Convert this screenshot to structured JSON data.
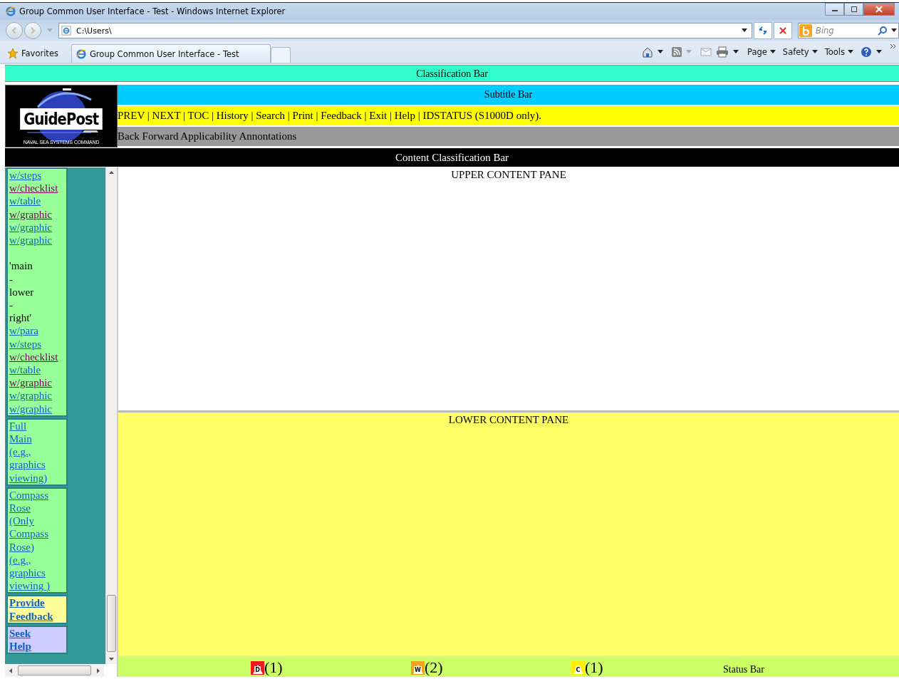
{
  "browser": {
    "title": "Group Common User Interface - Test - Windows Internet Explorer",
    "address": "C:\\Users\\",
    "search_placeholder": "Bing",
    "favorites": "Favorites",
    "tab_title": "Group Common User Interface - Test",
    "menus": [
      "Page",
      "Safety",
      "Tools"
    ]
  },
  "classification_bar": "Classification Bar",
  "logo": {
    "title": "GuidePost",
    "subtitle": "NAVAL SEA SYSTEMS COMMAND"
  },
  "subtitle_bar": "Subtitle Bar",
  "nav_bar": "PREV | NEXT | TOC | History | Search | Print | Feedback | Exit | Help | IDSTATUS (S1000D only).",
  "applicability_bar": "Back Forward Applicability Annontations",
  "content_classification_bar": "Content Classification Bar",
  "sidebar": {
    "boxes": [
      {
        "kind": "list",
        "items": [
          {
            "kind": "link",
            "text": "w/steps",
            "visited": false
          },
          {
            "kind": "link",
            "text": "w/checklist",
            "visited": true
          },
          {
            "kind": "link",
            "text": "w/table",
            "visited": false
          },
          {
            "kind": "link",
            "text": "w/graphic",
            "visited": true
          },
          {
            "kind": "link",
            "text": "w/graphic",
            "visited": false
          },
          {
            "kind": "link",
            "text": "w/graphic",
            "visited": false
          },
          {
            "kind": "note",
            "text": "'main\n-\nlower\n-\nright'"
          },
          {
            "kind": "link",
            "text": "w/para",
            "visited": false
          },
          {
            "kind": "link",
            "text": "w/steps",
            "visited": false
          },
          {
            "kind": "link",
            "text": "w/checklist",
            "visited": true
          },
          {
            "kind": "link",
            "text": "w/table",
            "visited": false
          },
          {
            "kind": "link",
            "text": "w/graphic",
            "visited": true
          },
          {
            "kind": "link",
            "text": "w/graphic",
            "visited": false
          },
          {
            "kind": "link",
            "text": "w/graphic",
            "visited": false
          }
        ]
      },
      {
        "kind": "list",
        "items": [
          {
            "kind": "link",
            "text": "Full\nMain\n(e.g.,\ngraphics\nviewing)",
            "visited": false
          }
        ]
      },
      {
        "kind": "list",
        "items": [
          {
            "kind": "link",
            "text": "Compass\nRose\n(Only\nCompass\nRose)\n(e.g.,\ngraphics\nviewing )",
            "visited": false
          }
        ]
      },
      {
        "kind": "feedback",
        "items": [
          {
            "kind": "link",
            "text": "Provide\nFeedback",
            "visited": false
          }
        ]
      },
      {
        "kind": "help",
        "items": [
          {
            "kind": "link",
            "text": "Seek\nHelp",
            "visited": false
          }
        ]
      }
    ]
  },
  "upper_pane": "UPPER CONTENT PANE",
  "lower_pane": "LOWER CONTENT PANE",
  "status_bar": {
    "alerts": [
      {
        "letter": "D",
        "count": "(1)",
        "color": "#ee1c1c"
      },
      {
        "letter": "W",
        "count": "(2)",
        "color": "#f4a020"
      },
      {
        "letter": "C",
        "count": "(1)",
        "color": "#ffee00"
      }
    ],
    "label": "Status Bar"
  }
}
